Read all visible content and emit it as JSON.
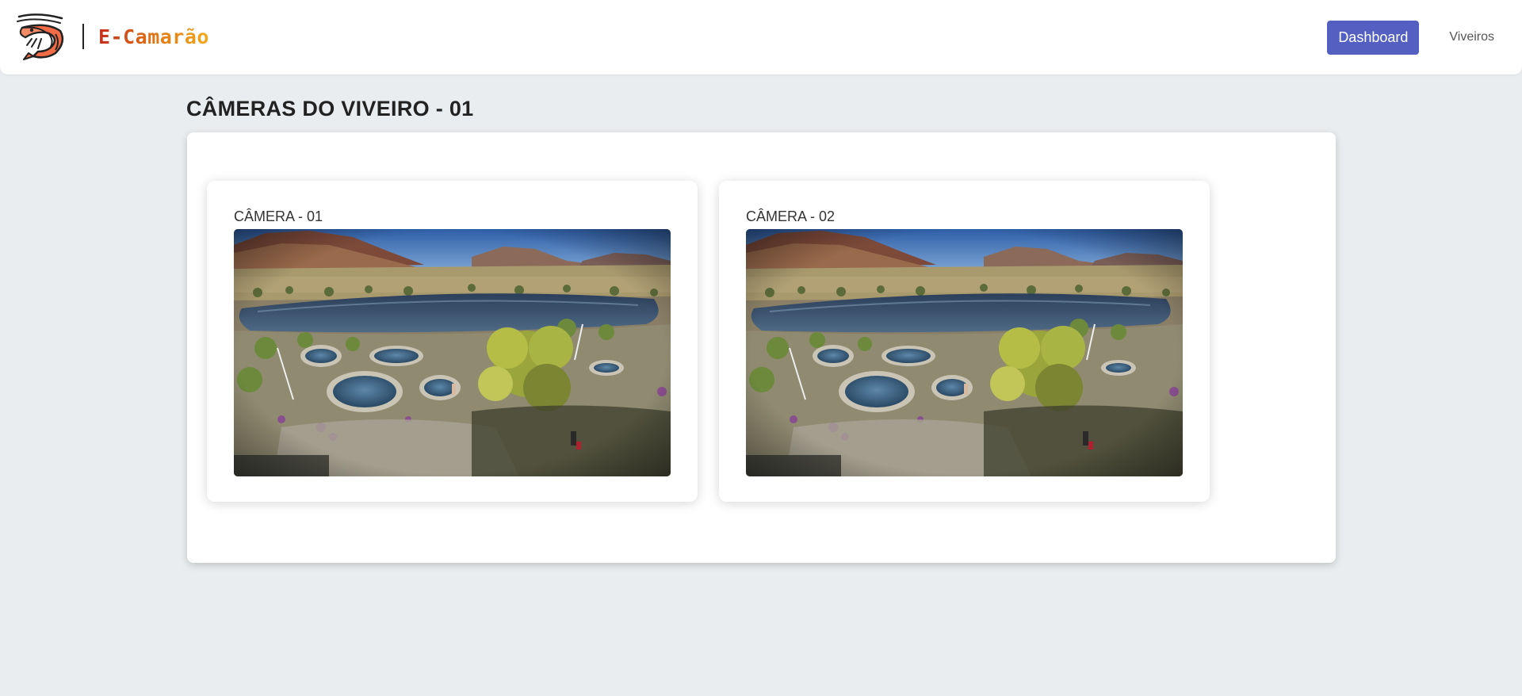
{
  "header": {
    "brand_name": "E-Camarão",
    "logo_icon": "shrimp-icon",
    "nav": {
      "dashboard_label": "Dashboard",
      "viveiros_label": "Viveiros"
    },
    "colors": {
      "accent": "#5360c2",
      "brand_start": "#c4301d",
      "brand_end": "#f2aa1c"
    }
  },
  "main": {
    "page_title": "CÂMERAS DO VIVEIRO - 01",
    "cameras": [
      {
        "label": "CÂMERA - 01",
        "feed_icon": "camera-feed-image"
      },
      {
        "label": "CÂMERA - 02",
        "feed_icon": "camera-feed-image"
      }
    ]
  }
}
